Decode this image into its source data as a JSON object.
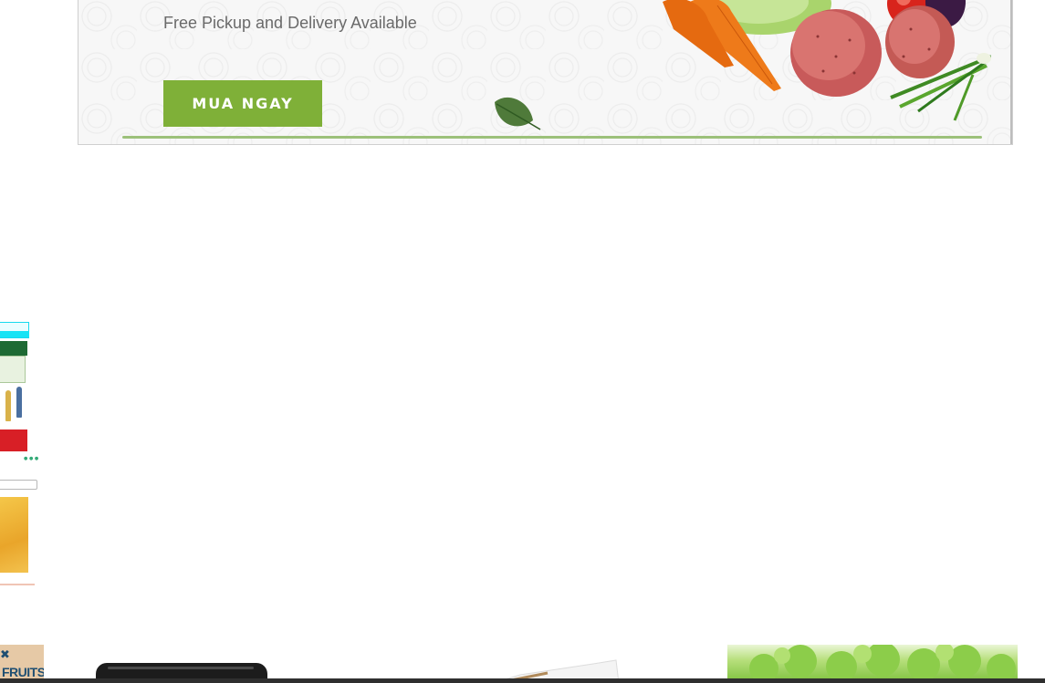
{
  "hero": {
    "subtitle": "Free Pickup and Delivery Available",
    "cta_label": "MUA NGAY"
  },
  "bottom_products": {
    "logo_text": "FRUITS"
  },
  "colors": {
    "accent": "#7fb038",
    "divider": "#9cc17a"
  }
}
